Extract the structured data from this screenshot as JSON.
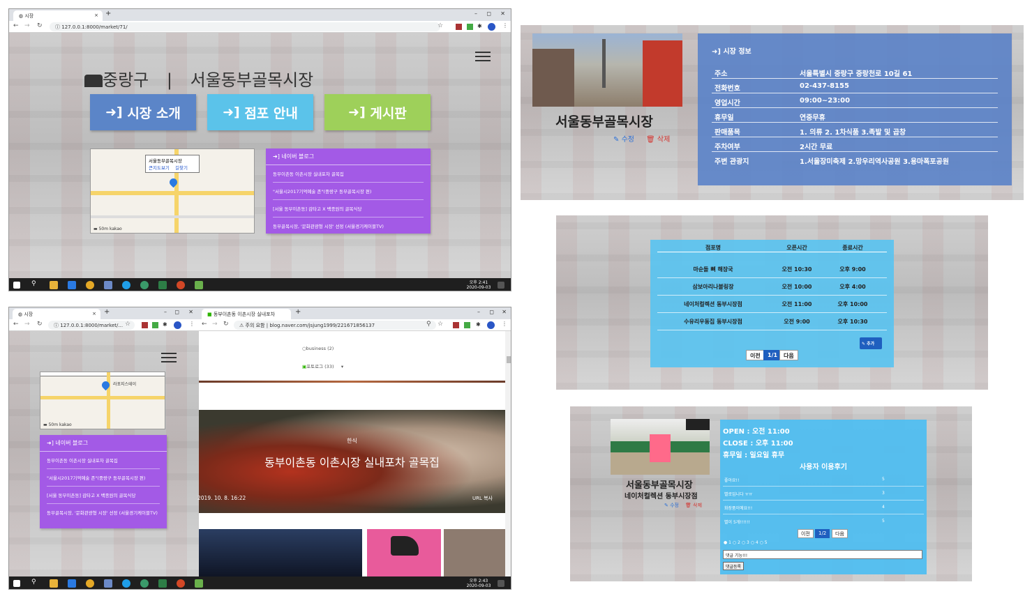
{
  "topleft": {
    "tab_title": "시장",
    "url": "127.0.0.1:8000/market/71/",
    "district": "중랑구",
    "separator": "|",
    "market_name": "서울동부골목시장",
    "btn_intro": "시장 소개",
    "btn_stores": "점포 안내",
    "btn_board": "게시판",
    "map_popup_title": "서울동부골목시장",
    "map_link_a": "큰지도보기",
    "map_link_b": "길찾기",
    "blog_title": "네이버 블로그",
    "blog_items": [
      "동부이촌동 이촌시장 실내포차 골목집",
      "\"서울시2017기억예술 존\"(중랑구 동부골목시장 편)",
      "[서울 동부이촌동] 감타고 X 백종원의 골목식당",
      "동부골목시장, '문화관광형 시장' 선정 (서울경기케이블TV)"
    ],
    "clock_time": "오후 2:41",
    "clock_date": "2020-09-03"
  },
  "topright": {
    "market_name": "서울동부골목시장",
    "edit": "수정",
    "delete": "삭제",
    "section_title": "시장 정보",
    "rows": [
      {
        "k": "주소",
        "v": "서울특별시 중랑구 중랑천로 10길 61"
      },
      {
        "k": "전화번호",
        "v": "02-437-8155"
      },
      {
        "k": "영업시간",
        "v": "09:00~23:00"
      },
      {
        "k": "휴무일",
        "v": "연중무휴"
      },
      {
        "k": "판매품목",
        "v": "1. 의류 2. 1차식품 3.족발 및 곱창"
      },
      {
        "k": "주차여부",
        "v": "2시간 무료"
      },
      {
        "k": "주변 관광지",
        "v": "1.서울장미축제 2.망우리역사공원 3.용마폭포공원"
      }
    ]
  },
  "midright": {
    "headers": [
      "점포명",
      "오픈시간",
      "종료시간"
    ],
    "rows": [
      [
        "마순돌 뼈 해장국",
        "오전 10:30",
        "오후 9:00"
      ],
      [
        "삼보아리나볼링장",
        "오전 10:00",
        "오후 4:00"
      ],
      [
        "네이처컬렉션 동부시장점",
        "오전 11:00",
        "오후 10:00"
      ],
      [
        "수유리우동집 동부시장점",
        "오전 9:00",
        "오후 10:30"
      ]
    ],
    "add_btn": "추가",
    "prev": "이전",
    "page": "1/1",
    "next": "다음"
  },
  "bottomleft": {
    "tab1_title": "시장",
    "url1": "127.0.0.1:8000/market/...",
    "tab2_title": "동부이촌동 이촌시장 실내포차",
    "security": "주의 요함",
    "url2": "blog.naver.com/jsjung1999/221671856137",
    "blog_title": "네이버 블로그",
    "blog_items": [
      "동부이촌동 이촌시장 실내포차 골목집",
      "\"서울시2017기억예술 존\"(중랑구 동부골목시장 편)",
      "[서울 동부이촌동] 감타고 X 백종원의 골목식당",
      "동부골목시장, '문화관광형 시장' 선정 (서울경기케이블TV)"
    ],
    "cat1": "business (2)",
    "cat2": "포토로그 (33)",
    "post_category": "한식",
    "post_title": "동부이촌동 이촌시장 실내포차 골목집",
    "post_date": "2019. 10. 8. 16:22",
    "post_url": "URL 복사",
    "map_label": "라포지스테이",
    "clock_time": "오후 2:43",
    "clock_date": "2020-09-03"
  },
  "bottomright": {
    "open": "OPEN : 오전 11:00",
    "close": "CLOSE : 오후 11:00",
    "holiday": "휴무일 : 일요일 휴무",
    "market_name": "서울동부골목시장",
    "store_name": "네이처컬렉션 동부시장점",
    "edit": "수정",
    "delete": "삭제",
    "reviews_title": "사용자 이용후기",
    "reviews": [
      {
        "text": "좋아요!!",
        "score": "5"
      },
      {
        "text": "별로입니다 ㅠㅠ",
        "score": "3"
      },
      {
        "text": "화장품이에요!!!",
        "score": "4"
      },
      {
        "text": "별이 5개!!!!!!",
        "score": "5"
      }
    ],
    "prev": "이전",
    "page": "1/2",
    "next": "다음",
    "rating_labels": [
      "1",
      "2",
      "3",
      "4",
      "5"
    ],
    "comment_value": "댓글 기능!!!",
    "submit": "댓글등록"
  }
}
